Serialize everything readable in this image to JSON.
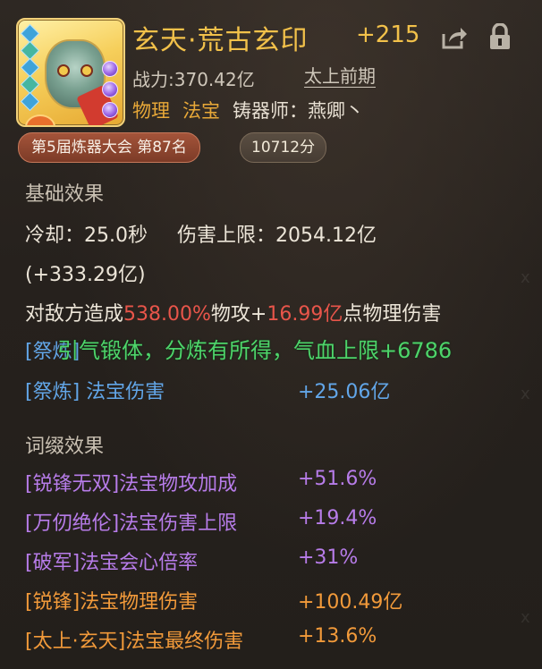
{
  "item": {
    "name": "玄天·荒古玄印",
    "enhance_level": "+215",
    "power_label": "战力:",
    "power_value": "370.42亿",
    "realm": "太上前期",
    "attribute": "物理",
    "category": "法宝",
    "smith_label": "铸器师：",
    "smith_name": "燕卿丶",
    "icon": "treasure-seal-icon"
  },
  "badges": {
    "rank": "第5届炼器大会 第87名",
    "score": "10712分"
  },
  "basic": {
    "section_title": "基础效果",
    "cooldown_label": "冷却：",
    "cooldown_value": "25.0秒",
    "dmg_cap_label": "伤害上限：",
    "dmg_cap_value": "2054.12亿",
    "dmg_cap_bonus": "(+333.29亿)",
    "deal_prefix": "对敌方造成",
    "deal_pct": "538.00%",
    "deal_mid": "物攻+",
    "deal_flat": "16.99亿",
    "deal_suffix": "点物理伤害",
    "refine_rows": [
      {
        "tag": "[祭炼]",
        "name": "",
        "value": ""
      },
      {
        "tag": "[祭炼]",
        "name": "法宝伤害",
        "value": "+25.06亿"
      }
    ]
  },
  "system_message": "引气锻体，分炼有所得，气血上限+6786",
  "affix": {
    "section_title": "词缀效果",
    "rows": [
      {
        "tag": "[锐锋无双]",
        "name": "法宝物攻加成",
        "value": "+51.6%"
      },
      {
        "tag": "[万仞绝伦]",
        "name": "法宝伤害上限",
        "value": "+19.4%"
      },
      {
        "tag": "[破军]",
        "name": "法宝会心倍率",
        "value": "+31%"
      },
      {
        "tag": "[锐锋]",
        "name": "法宝物理伤害",
        "value": "+100.49亿"
      },
      {
        "tag": "[太上·玄天]",
        "name": "法宝最终伤害",
        "value": "+13.6%"
      }
    ]
  },
  "colors": {
    "title": "#f2c14a",
    "refine": "#62a6e8",
    "affix_purple": "#b77ce9",
    "affix_orange": "#f29a3a",
    "damage_red": "#e8554a",
    "message_green": "#4ed46a"
  },
  "icons": [
    "share-icon",
    "lock-icon"
  ]
}
